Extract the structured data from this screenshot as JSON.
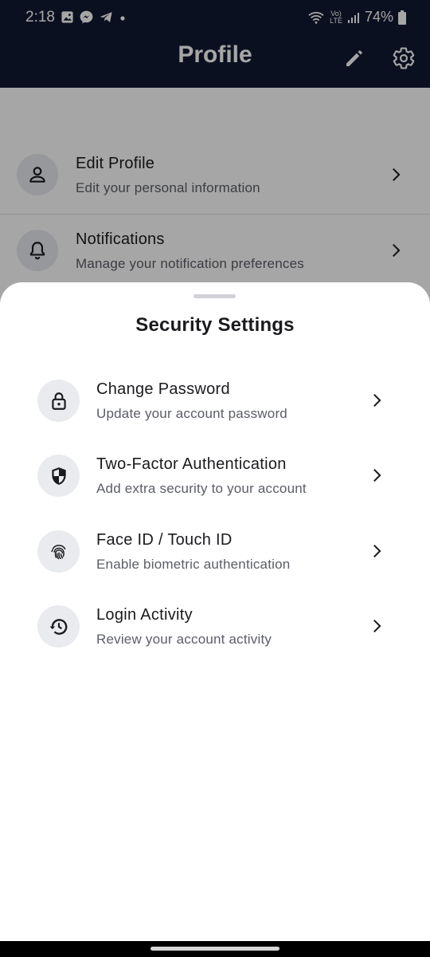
{
  "status_bar": {
    "time": "2:18",
    "network_small_top": "Vo)",
    "network_small_bottom": "LTE",
    "battery": "74%"
  },
  "app_bar": {
    "title": "Profile"
  },
  "profile_menu": {
    "items": [
      {
        "icon": "person-icon",
        "title": "Edit Profile",
        "subtitle": "Edit your personal information"
      },
      {
        "icon": "bell-icon",
        "title": "Notifications",
        "subtitle": "Manage your notification preferences"
      }
    ]
  },
  "security_sheet": {
    "title": "Security Settings",
    "items": [
      {
        "icon": "lock-icon",
        "title": "Change Password",
        "subtitle": "Update your account password"
      },
      {
        "icon": "shield-icon",
        "title": "Two-Factor Authentication",
        "subtitle": "Add extra security to your account"
      },
      {
        "icon": "fingerprint-icon",
        "title": "Face ID / Touch ID",
        "subtitle": "Enable biometric authentication"
      },
      {
        "icon": "history-icon",
        "title": "Login Activity",
        "subtitle": "Review your account activity"
      }
    ]
  },
  "colors": {
    "app_bar": "#121a33",
    "scrim": "rgba(0,0,0,0.35)",
    "icon_bg": "#e9ebee",
    "text_primary": "#1b1b1f",
    "text_secondary": "#5b5e66"
  }
}
